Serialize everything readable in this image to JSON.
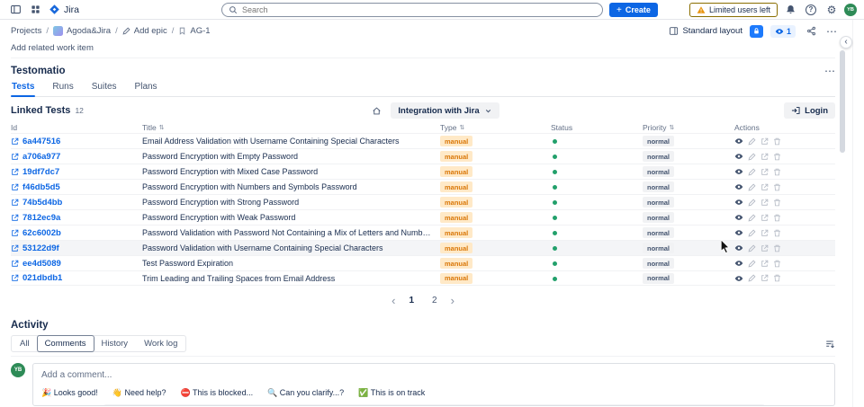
{
  "colors": {
    "accent_blue": "#0c66e4",
    "status_green": "#22a06b",
    "manual_badge_bg": "#ffe9c7",
    "manual_badge_text": "#d97708",
    "normal_badge_bg": "#f1f2f4",
    "normal_badge_text": "#44546f"
  },
  "topbar": {
    "app_name": "Jira",
    "search_placeholder": "Search",
    "create_label": "Create",
    "limited_users_label": "Limited users left",
    "user_initials": "YB"
  },
  "breadcrumbs": {
    "projects": "Projects",
    "project_name": "Agoda&Jira",
    "add_epic": "Add epic",
    "issue_key": "AG-1"
  },
  "view_toolbar": {
    "layout_label": "Standard layout",
    "watchers_count": "1"
  },
  "work_item": {
    "add_related_label": "Add related work item"
  },
  "testomatio": {
    "title": "Testomatio",
    "tabs": [
      "Tests",
      "Runs",
      "Suites",
      "Plans"
    ],
    "active_tab": "Tests"
  },
  "linked_tests": {
    "title": "Linked Tests",
    "count": "12",
    "integration_label": "Integration with Jira",
    "login_label": "Login",
    "columns": [
      "Id",
      "Title",
      "Type",
      "Status",
      "Priority",
      "Actions"
    ],
    "hovered_row_id": "53122d9f",
    "rows": [
      {
        "id": "6a447516",
        "title": "Email Address Validation with Username Containing Special Characters",
        "type": "manual",
        "status": "green",
        "priority": "normal"
      },
      {
        "id": "a706a977",
        "title": "Password Encryption with Empty Password",
        "type": "manual",
        "status": "green",
        "priority": "normal"
      },
      {
        "id": "19df7dc7",
        "title": "Password Encryption with Mixed Case Password",
        "type": "manual",
        "status": "green",
        "priority": "normal"
      },
      {
        "id": "f46db5d5",
        "title": "Password Encryption with Numbers and Symbols Password",
        "type": "manual",
        "status": "green",
        "priority": "normal"
      },
      {
        "id": "74b5d4bb",
        "title": "Password Encryption with Strong Password",
        "type": "manual",
        "status": "green",
        "priority": "normal"
      },
      {
        "id": "7812ec9a",
        "title": "Password Encryption with Weak Password",
        "type": "manual",
        "status": "green",
        "priority": "normal"
      },
      {
        "id": "62c6002b",
        "title": "Password Validation with Password Not Containing a Mix of Letters and Numbers",
        "type": "manual",
        "status": "green",
        "priority": "normal"
      },
      {
        "id": "53122d9f",
        "title": "Password Validation with Username Containing Special Characters",
        "type": "manual",
        "status": "green",
        "priority": "normal"
      },
      {
        "id": "ee4d5089",
        "title": "Test Password Expiration",
        "type": "manual",
        "status": "green",
        "priority": "normal"
      },
      {
        "id": "021dbdb1",
        "title": "Trim Leading and Trailing Spaces from Email Address",
        "type": "manual",
        "status": "green",
        "priority": "normal"
      }
    ],
    "pagination": {
      "prev": "‹",
      "pages": [
        "1",
        "2"
      ],
      "active_page": "1",
      "next": "›"
    }
  },
  "activity": {
    "title": "Activity",
    "tabs": [
      "All",
      "Comments",
      "History",
      "Work log"
    ],
    "active_tab": "Comments",
    "comment_placeholder": "Add a comment...",
    "quick_replies": [
      "🎉 Looks good!",
      "👋 Need help?",
      "⛔ This is blocked...",
      "🔍 Can you clarify...?",
      "✅ This is on track"
    ]
  }
}
